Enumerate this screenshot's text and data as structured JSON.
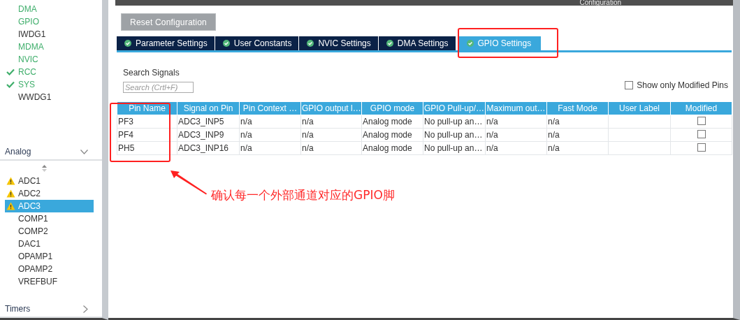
{
  "header": {
    "title": "Configuration"
  },
  "sidebar": {
    "items": [
      {
        "label": "DMA",
        "kind": "configured",
        "selected": false
      },
      {
        "label": "GPIO",
        "kind": "configured",
        "selected": false
      },
      {
        "label": "IWDG1",
        "kind": "plain",
        "selected": false
      },
      {
        "label": "MDMA",
        "kind": "configured",
        "selected": false
      },
      {
        "label": "NVIC",
        "kind": "configured",
        "selected": false
      },
      {
        "label": "RCC",
        "kind": "checked",
        "selected": false
      },
      {
        "label": "SYS",
        "kind": "checked",
        "selected": false
      },
      {
        "label": "WWDG1",
        "kind": "plain",
        "selected": false
      }
    ],
    "groups": [
      {
        "label": "Analog",
        "expanded": true,
        "items": [
          {
            "label": "ADC1",
            "kind": "warning",
            "selected": false
          },
          {
            "label": "ADC2",
            "kind": "warning",
            "selected": false
          },
          {
            "label": "ADC3",
            "kind": "warning",
            "selected": true
          },
          {
            "label": "COMP1",
            "kind": "plain",
            "selected": false
          },
          {
            "label": "COMP2",
            "kind": "plain",
            "selected": false
          },
          {
            "label": "DAC1",
            "kind": "plain",
            "selected": false
          },
          {
            "label": "OPAMP1",
            "kind": "plain",
            "selected": false
          },
          {
            "label": "OPAMP2",
            "kind": "plain",
            "selected": false
          },
          {
            "label": "VREFBUF",
            "kind": "plain",
            "selected": false
          }
        ]
      },
      {
        "label": "Timers",
        "expanded": false
      }
    ]
  },
  "reset_button": "Reset Configuration",
  "tabs": [
    {
      "label": "Parameter Settings",
      "selected": false
    },
    {
      "label": "User Constants",
      "selected": false
    },
    {
      "label": "NVIC Settings",
      "selected": false
    },
    {
      "label": "DMA Settings",
      "selected": false
    },
    {
      "label": "GPIO Settings",
      "selected": true
    }
  ],
  "search": {
    "label": "Search Signals",
    "placeholder": "Search (Crtl+F)"
  },
  "show_modified": {
    "label": "Show only Modified Pins",
    "checked": false
  },
  "table": {
    "columns": [
      "Pin Name",
      "Signal on Pin",
      "Pin Context …",
      "GPIO output l…",
      "GPIO mode",
      "GPIO Pull-up/…",
      "Maximum out…",
      "Fast Mode",
      "User Label",
      "Modified"
    ],
    "rows": [
      {
        "cells": [
          "PF3",
          "ADC3_INP5",
          "n/a",
          "n/a",
          "Analog mode",
          "No pull-up an…",
          "n/a",
          "n/a",
          ""
        ],
        "modified": false
      },
      {
        "cells": [
          "PF4",
          "ADC3_INP9",
          "n/a",
          "n/a",
          "Analog mode",
          "No pull-up an…",
          "n/a",
          "n/a",
          ""
        ],
        "modified": false
      },
      {
        "cells": [
          "PH5",
          "ADC3_INP16",
          "n/a",
          "n/a",
          "Analog mode",
          "No pull-up an…",
          "n/a",
          "n/a",
          ""
        ],
        "modified": false
      }
    ]
  },
  "annotation": {
    "note": "确认每一个外部通道对应的GPIO脚"
  }
}
